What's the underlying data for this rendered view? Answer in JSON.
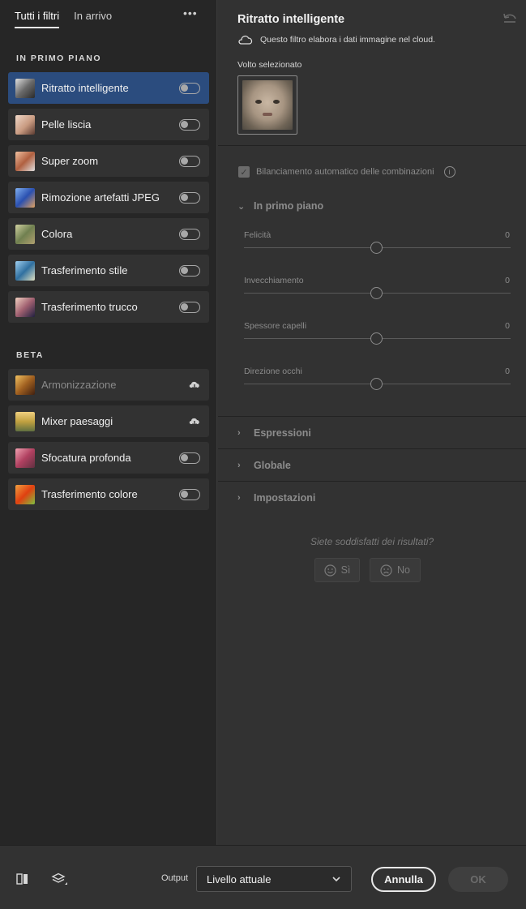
{
  "left": {
    "tabs": [
      {
        "label": "Tutti i filtri"
      },
      {
        "label": "In arrivo"
      }
    ],
    "more_label": "•••",
    "sections": {
      "featured": "IN PRIMO PIANO",
      "beta": "BETA"
    },
    "featured": [
      {
        "label": "Ritratto intelligente",
        "thumb_color": "#a0a0a0"
      },
      {
        "label": "Pelle liscia",
        "thumb_color": "#d8b8a0"
      },
      {
        "label": "Super zoom",
        "thumb_color": "#c08060"
      },
      {
        "label": "Rimozione artefatti JPEG",
        "thumb_color": "#3a5fb0"
      },
      {
        "label": "Colora",
        "thumb_color": "#9aa070"
      },
      {
        "label": "Trasferimento stile",
        "thumb_color": "#4a8ab0"
      },
      {
        "label": "Trasferimento trucco",
        "thumb_color": "#8a6a7a"
      }
    ],
    "beta": [
      {
        "label": "Armonizzazione",
        "thumb_color": "#b07a30"
      },
      {
        "label": "Mixer paesaggi",
        "thumb_color": "#c0a040"
      },
      {
        "label": "Sfocatura profonda",
        "thumb_color": "#c06080"
      },
      {
        "label": "Trasferimento colore",
        "thumb_color": "#e05020"
      }
    ]
  },
  "right": {
    "title": "Ritratto intelligente",
    "cloud_note": "Questo filtro elabora i dati immagine nel cloud.",
    "face_label": "Volto selezionato",
    "auto_balance": "Bilanciamento automatico delle combinazioni",
    "info_icon": "i",
    "featured_group": "In primo piano",
    "sliders": [
      {
        "label": "Felicità",
        "value": "0"
      },
      {
        "label": "Invecchiamento",
        "value": "0"
      },
      {
        "label": "Spessore capelli",
        "value": "0"
      },
      {
        "label": "Direzione occhi",
        "value": "0"
      }
    ],
    "groups": [
      "Espressioni",
      "Globale",
      "Impostazioni"
    ],
    "feedback_question": "Siete soddisfatti dei risultati?",
    "feedback_yes": "Sì",
    "feedback_no": "No"
  },
  "bottom": {
    "output_label": "Output",
    "output_value": "Livello attuale",
    "cancel_label": "Annulla",
    "ok_label": "OK"
  }
}
